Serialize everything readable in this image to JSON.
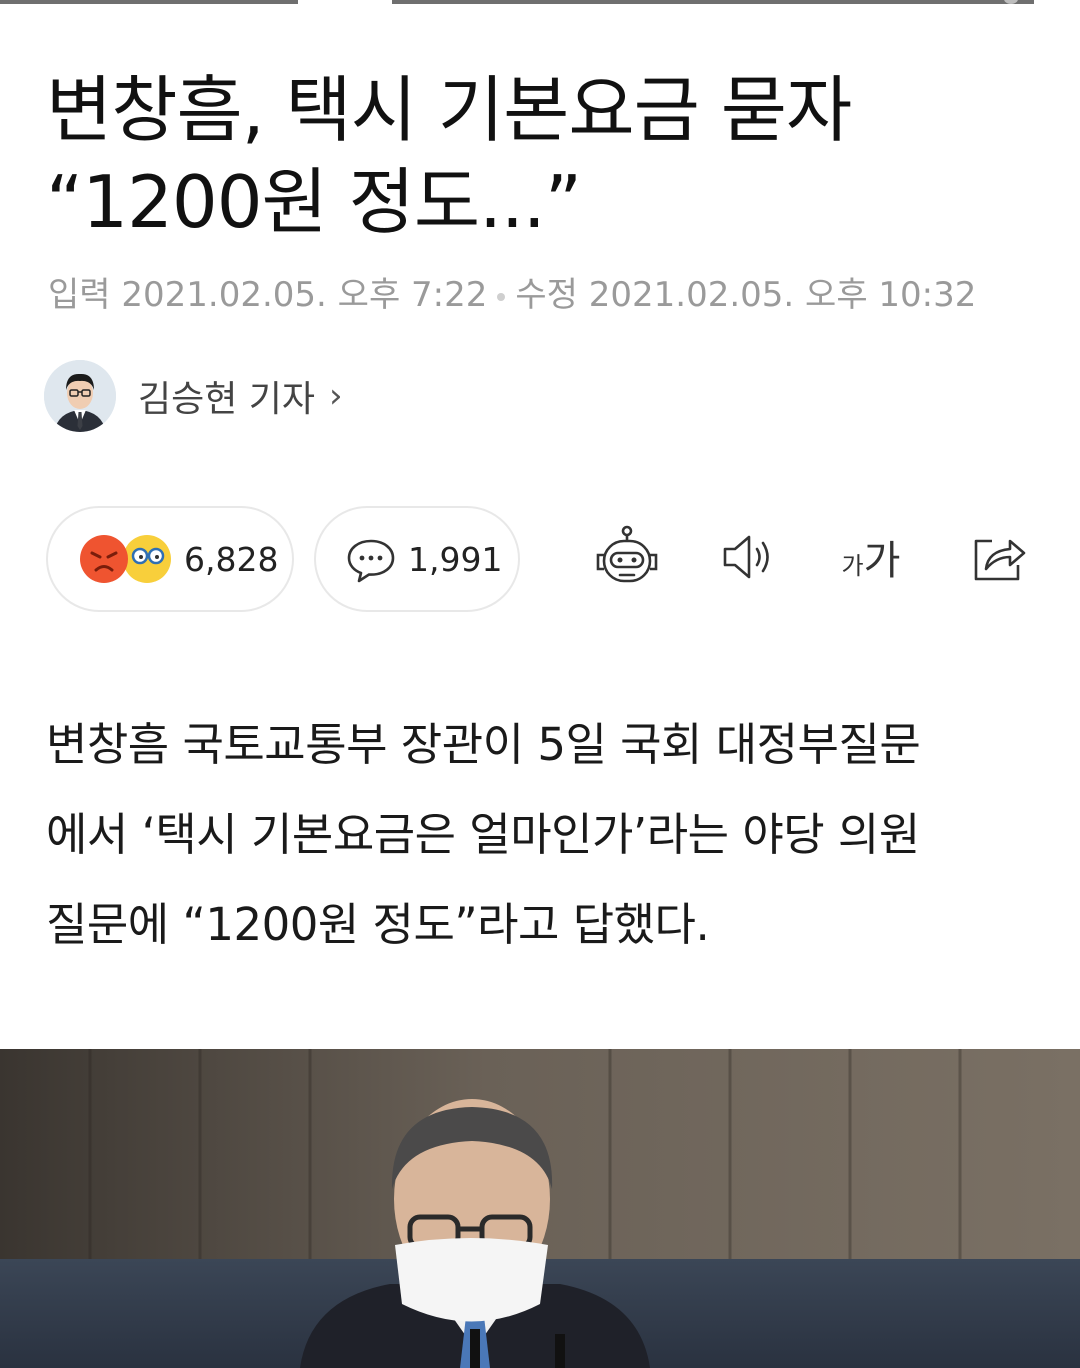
{
  "headline": {
    "line1": "변창흠, 택시 기본요금 묻자",
    "line2": "“1200원 정도...”"
  },
  "meta": {
    "input_label": "입력",
    "input_time": "2021.02.05. 오후 7:22",
    "edit_label": "수정",
    "edit_time": "2021.02.05. 오후 10:32"
  },
  "author": {
    "name": "김승현 기자",
    "chevron": "›"
  },
  "reactions": {
    "count": "6,828",
    "icons": [
      "angry-emoji",
      "glasses-emoji"
    ],
    "colors": {
      "angry": "#ef5430",
      "glasses": "#f8cf3b"
    }
  },
  "comments": {
    "count": "1,991",
    "icon": "speech-bubble-icon"
  },
  "toolbar": {
    "summary_bot_icon": "robot-icon",
    "tts_icon": "speaker-icon",
    "font_size_label_small": "가",
    "font_size_label_large": "가",
    "share_icon": "share-icon"
  },
  "article": {
    "lines": [
      "변창흠 국토교통부 장관이 5일 국회 대정부질문",
      "에서 ‘택시 기본요금은 얼마인가’라는 야당 의원",
      "질문에 “1200원 정도”라고 답했다."
    ]
  },
  "photo": {
    "description_icon": "news-photo"
  }
}
